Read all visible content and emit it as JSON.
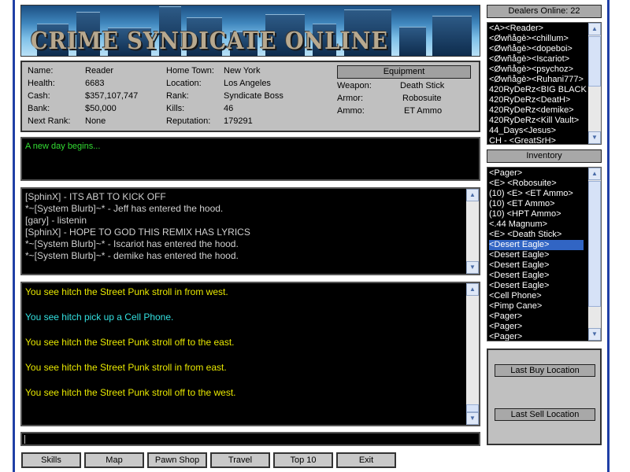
{
  "banner": {
    "title": "CRIME SYNDICATE ONLINE"
  },
  "stats": {
    "col1": [
      {
        "label": "Name:",
        "value": "Reader"
      },
      {
        "label": "Health:",
        "value": "6683"
      },
      {
        "label": "Cash:",
        "value": "$357,107,747"
      },
      {
        "label": "Bank:",
        "value": "$50,000"
      },
      {
        "label": "Next Rank:",
        "value": "None"
      }
    ],
    "col2": [
      {
        "label": "Home Town:",
        "value": "New York"
      },
      {
        "label": "Location:",
        "value": "Los Angeles"
      },
      {
        "label": "Rank:",
        "value": "Syndicate Boss"
      },
      {
        "label": "Kills:",
        "value": "46"
      },
      {
        "label": "Reputation:",
        "value": "179291"
      }
    ],
    "equipment_label": "Equipment",
    "equipment": [
      {
        "label": "Weapon:",
        "value": "Death Stick"
      },
      {
        "label": "Armor:",
        "value": "Robosuite"
      },
      {
        "label": "Ammo:",
        "value": "ET Ammo"
      }
    ]
  },
  "system_log": [
    "A new day begins..."
  ],
  "chat_log": [
    "[SphinX] - ITS ABT TO KICK OFF",
    "*~[System Blurb]~* - Jeff has entered the hood.",
    "[gary] - listenin",
    "[SphinX] - HOPE TO GOD THIS REMIX HAS LYRICS",
    "*~[System Blurb]~* - Iscariot has entered the hood.",
    "*~[System Blurb]~* - demike has entered the hood."
  ],
  "room_log": [
    {
      "text": "You see hitch the Street Punk stroll in from west.",
      "color": "#e8e800"
    },
    {
      "text": "You see hitch pick up a Cell Phone.",
      "color": "#33e0e0"
    },
    {
      "text": "You see hitch the Street Punk stroll off to the east.",
      "color": "#e8e800"
    },
    {
      "text": "You see hitch the Street Punk stroll in from east.",
      "color": "#e8e800"
    },
    {
      "text": "You see hitch the Street Punk stroll off to the west.",
      "color": "#e8e800"
    }
  ],
  "dealers": {
    "header": "Dealers Online: 22",
    "items": [
      "<A><Reader>",
      "<Øwñågè><chillum>",
      "<Øwñågè><dopeboi>",
      "<Øwñågè><Iscariot>",
      "<Øwñågè><psychoz>",
      "<Øwñågè><Ruhani777>",
      "420RyDeRz<BIG BLACK",
      "420RyDeRz<DeatH>",
      "420RyDeRz<demike>",
      "420RyDeRz<Kill Vault>",
      "44_Days<Jesus>",
      "CH - <GreatSrH>"
    ]
  },
  "inventory": {
    "header": "Inventory",
    "selected_index": 7,
    "items": [
      "<Pager>",
      "<E> <Robosuite>",
      "(10) <E> <ET Ammo>",
      "(10) <ET Ammo>",
      "(10) <HPT Ammo>",
      "<.44 Magnum>",
      "<E> <Death Stick>",
      "<Desert Eagle>",
      "<Desert Eagle>",
      "<Desert Eagle>",
      "<Desert Eagle>",
      "<Desert Eagle>",
      "<Cell Phone>",
      "<Pimp Cane>",
      "<Pager>",
      "<Pager>",
      "<Pager>"
    ]
  },
  "actions": {
    "last_buy": "Last Buy Location",
    "last_sell": "Last Sell Location"
  },
  "bottom_buttons": [
    "Skills",
    "Map",
    "Pawn Shop",
    "Travel",
    "Top 10",
    "Exit"
  ]
}
